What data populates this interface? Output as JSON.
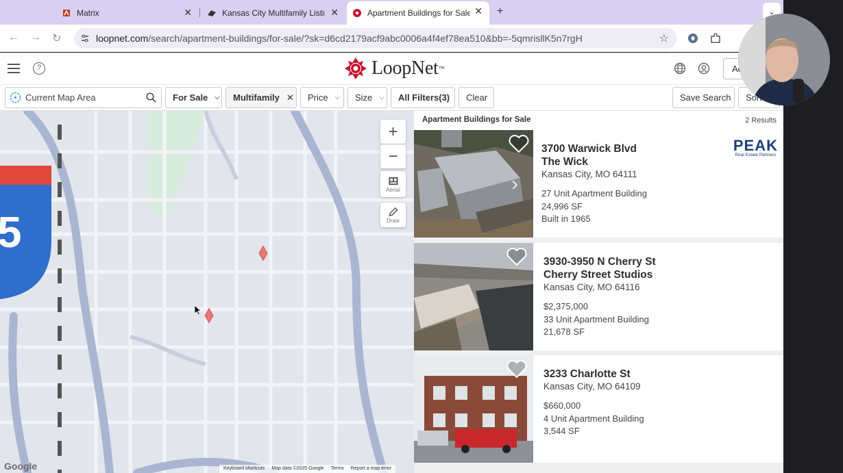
{
  "browser": {
    "tabs": [
      {
        "title": "Matrix",
        "close": "✕"
      },
      {
        "title": "Kansas City Multifamily Listin",
        "close": "✕"
      },
      {
        "title": "Apartment Buildings for Sale",
        "close": "✕"
      }
    ],
    "new_tab": "+",
    "tab_menu": "⌄",
    "url_domain": "loopnet.com",
    "url_path": "/search/apartment-buildings/for-sale/?sk=d6cd2179acf9abc0006a4f4ef78ea510&bb=-5qmrisllK5n7rgH",
    "back": "←",
    "forward": "→",
    "reload": "↻",
    "bookmark": "☆"
  },
  "header": {
    "logo_text": "LoopNet",
    "logo_tm": "™",
    "add_button": "Ad",
    "help": "?"
  },
  "filters": {
    "location_placeholder": "Current Map Area",
    "for_sale": "For Sale",
    "multifamily": "Multifamily",
    "multifamily_clear": "✕",
    "price": "Price",
    "size": "Size",
    "all_filters": "All Filters(3)",
    "clear": "Clear",
    "save_search": "Save Search",
    "sort": "Sort"
  },
  "map": {
    "zoom_in": "+",
    "zoom_out": "−",
    "aerial": "Aerial",
    "draw": "Draw",
    "google": "Google",
    "highway_shield": "5",
    "footer": [
      "Keyboard shortcuts",
      "Map data ©2025 Google",
      "Terms",
      "Report a map error"
    ]
  },
  "results": {
    "title": "Apartment Buildings for Sale",
    "count": "2 Results",
    "listings": [
      {
        "address": "3700 Warwick Blvd",
        "name": "The Wick",
        "city": "Kansas City, MO 64111",
        "line1": "27 Unit Apartment Building",
        "line2": "24,996 SF",
        "line3": "Built in 1965",
        "broker_logo": "PEAK",
        "broker_sub": "Real Estate Partners"
      },
      {
        "address": "3930-3950 N Cherry St",
        "name": "Cherry Street Studios",
        "city": "Kansas City, MO 64116",
        "line1": "$2,375,000",
        "line2": "33 Unit Apartment Building",
        "line3": "21,678 SF"
      },
      {
        "address": "3233 Charlotte St",
        "city": "Kansas City, MO 64109",
        "line1": "$660,000",
        "line2": "4 Unit Apartment Building",
        "line3": "3,544 SF"
      }
    ]
  },
  "colors": {
    "tabstrip": "#d9d0f1",
    "loopnet_red": "#c8102e",
    "map_road": "#a9b6d2",
    "peak_blue": "#1d3f77"
  }
}
